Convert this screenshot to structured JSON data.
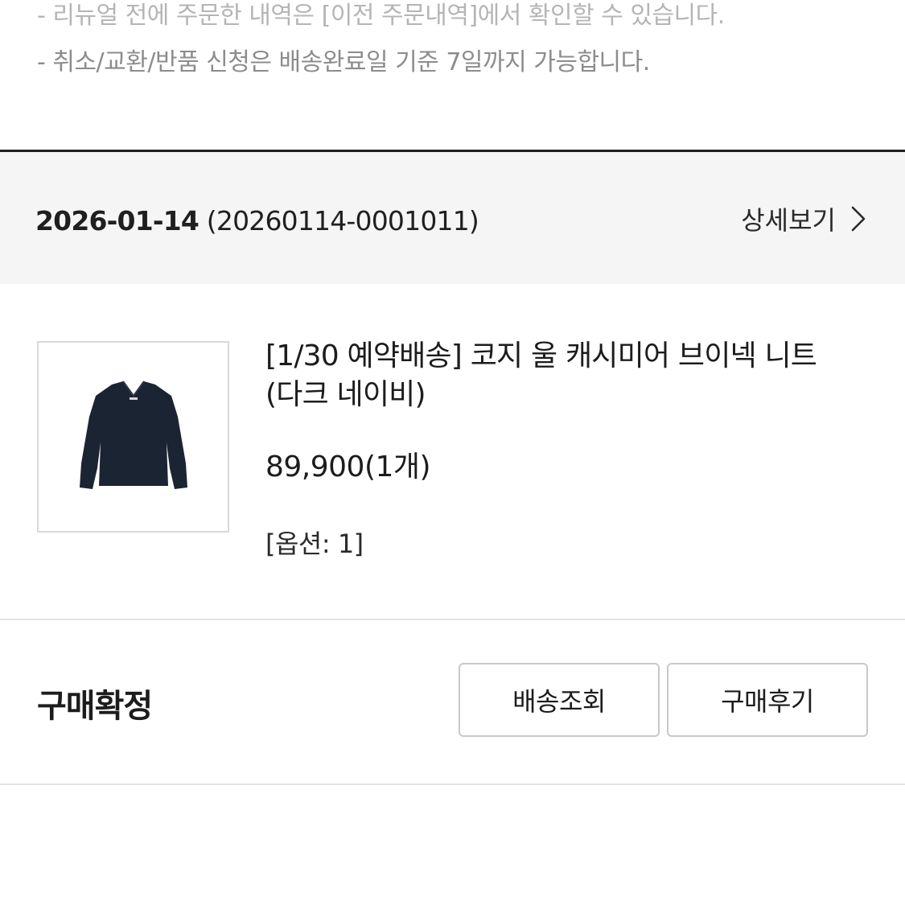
{
  "notice": {
    "line1": "- 리뉴얼 전에 주문한 내역은 [이전 주문내역]에서 확인할 수 있습니다.",
    "line2": "- 취소/교환/반품 신청은 배송완료일 기준 7일까지 가능합니다."
  },
  "order": {
    "date": "2026-01-14",
    "number": "(20260114-0001011)",
    "detail_label": "상세보기"
  },
  "product": {
    "image_icon": "navy-v-neck-sweater",
    "name": "[1/30 예약배송] 코지 울 캐시미어 브이넥 니트 (다크 네이비)",
    "price": "89,900(1개)",
    "option": "[옵션: 1]"
  },
  "status": {
    "label": "구매확정",
    "track_button": "배송조회",
    "review_button": "구매후기"
  },
  "colors": {
    "header_bg": "#f5f5f5",
    "sweater": "#1b2433",
    "text": "#1c1c1c",
    "muted": "#8c8c8c"
  }
}
